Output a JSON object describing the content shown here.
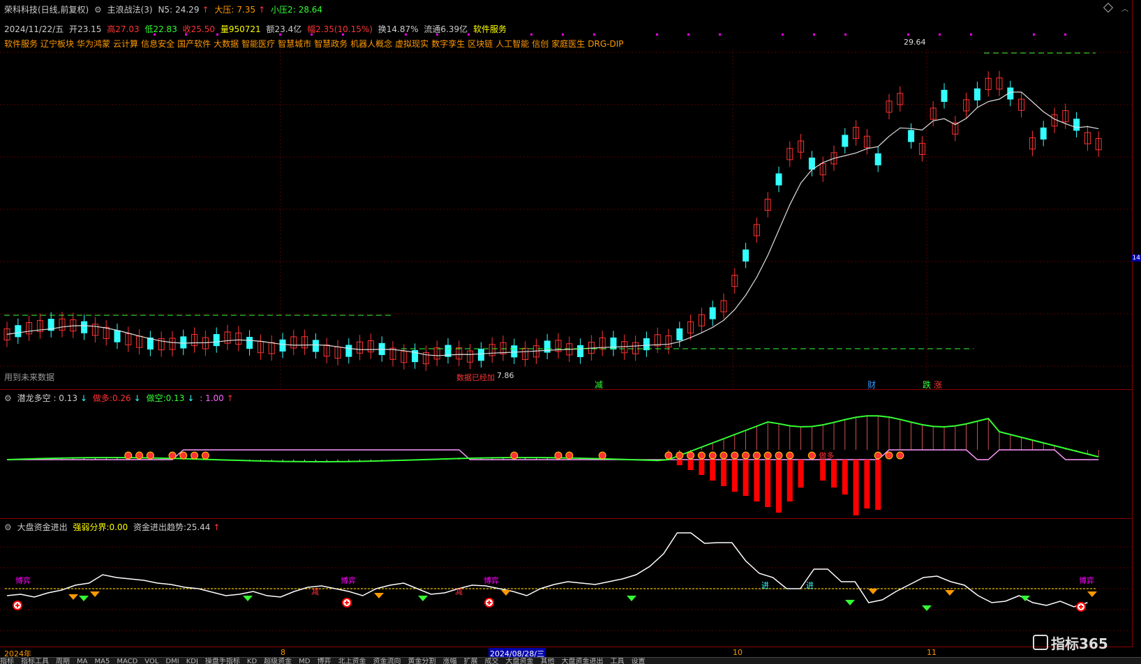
{
  "main": {
    "stock_name": "荣科科技(日线,前复权)",
    "indicator_name": "主浪战法(3)",
    "n5_label": "N5:",
    "n5_value": "24.29",
    "dya_label": "大压:",
    "dya_value": "7.35",
    "xya_label": "小压2:",
    "xya_value": "28.64",
    "date": "2024/11/22/五",
    "open_label": "开",
    "open": "23.15",
    "high_label": "高",
    "high": "27.03",
    "low_label": "低",
    "low": "22.83",
    "close_label": "收",
    "close": "25.50",
    "vol_label": "量",
    "vol": "950721",
    "amt_label": "额",
    "amt": "23.4亿",
    "chg_label": "幅",
    "chg": "2.35(10.15%)",
    "turnover": "换14.87%",
    "float": "流通6.39亿",
    "sector": "软件服务",
    "concepts": [
      "软件服务",
      "辽宁板块",
      "华为鸿蒙",
      "云计算",
      "信息安全",
      "国产软件",
      "大数据",
      "智能医疗",
      "智慧城市",
      "智慧政务",
      "机器人概念",
      "虚拟现实",
      "数字孪生",
      "区块链",
      "人工智能",
      "信创",
      "家庭医生",
      "DRG-DIP"
    ],
    "high_marker": "29.64",
    "low_marker": "7.86",
    "low_text": "数据已经加",
    "future_data": "用到未来数据",
    "marks": [
      {
        "t": "减",
        "c": "#33ff33"
      },
      {
        "t": "财",
        "c": "#3399ff"
      },
      {
        "t": "跌",
        "c": "#33ff33"
      },
      {
        "t": "涨",
        "c": "#ff3333"
      }
    ]
  },
  "ind1": {
    "name": "潜龙多空",
    "value": ": 0.13",
    "zd_label": "做多:",
    "zd_value": "0.26",
    "zk_label": "做空:",
    "zk_value": "0.13",
    "extra": ": 1.00",
    "marker_text": "做多"
  },
  "ind2": {
    "name": "大盘资金进出",
    "qr_label": "强弱分界:",
    "qr_value": "0.00",
    "zj_label": "资金进出趋势:",
    "zj_value": "25.44",
    "tag_buy": "进",
    "tag_sell": "减",
    "tag_pink": "博弈"
  },
  "xaxis": [
    "2024年",
    "8",
    "2024/08/28/三",
    "10",
    "11"
  ],
  "tabs": [
    "指标",
    "指标工具",
    "周期",
    "MA",
    "MA5",
    "MACD",
    "VOL",
    "DMI",
    "KDJ",
    "操盘手指标",
    "KD",
    "超级资金",
    "MD",
    "博弈",
    "北上资金",
    "资金流向",
    "黄金分割",
    "涨幅",
    "扩展",
    "成交",
    "大盘资金",
    "其他",
    "大盘资金进出",
    "工具",
    "设置"
  ],
  "brand": "指标365",
  "right_label": "14",
  "colors": {
    "up": "#ff3333",
    "down": "#33ffff",
    "ma": "#e0e0e0",
    "green": "#33ff33",
    "magenta": "#ff00ff",
    "yellow": "#ffff00",
    "orange": "#ff9900"
  }
}
